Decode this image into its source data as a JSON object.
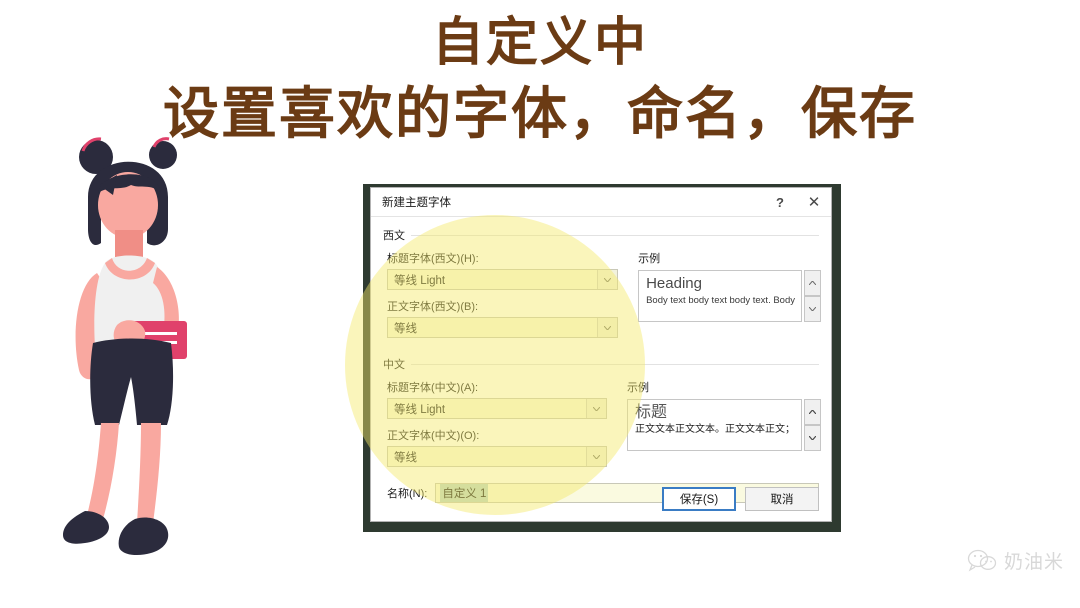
{
  "headline": {
    "line1": "自定义中",
    "line2": "设置喜欢的字体，命名，保存",
    "color": "#6b3b14"
  },
  "dialog": {
    "title": "新建主题字体",
    "help_icon": "?",
    "close_icon": "✕",
    "latin": {
      "group_label": "西文",
      "heading_font_label": "标题字体(西文)(H):",
      "heading_font_value": "等线 Light",
      "body_font_label": "正文字体(西文)(B):",
      "body_font_value": "等线",
      "sample_label": "示例",
      "sample_heading": "Heading",
      "sample_body": "Body text body text body text. Body"
    },
    "chinese": {
      "group_label": "中文",
      "heading_font_label": "标题字体(中文)(A):",
      "heading_font_value": "等线 Light",
      "body_font_label": "正文字体(中文)(O):",
      "body_font_value": "等线",
      "sample_label": "示例",
      "sample_heading": "标题",
      "sample_body": "正文文本正文文本。正文文本正文；"
    },
    "name": {
      "label": "名称(N):",
      "value": "自定义 1"
    },
    "buttons": {
      "save": "保存(S)",
      "cancel": "取消"
    },
    "accent_color": "#3a7cc4",
    "field_highlight_color": "#fafae0",
    "selection_color": "#bcd6c8"
  },
  "watermark": {
    "text": "奶油米",
    "icon": "wechat-icon"
  },
  "illustration": {
    "name": "girl-with-card",
    "skin": "#f9a8a0",
    "hair": "#2b2b3d",
    "top": "#f0f0f0",
    "shorts": "#2b2b3d",
    "card": "#e0416b"
  },
  "spotlight": {
    "name": "yellow-highlight-circle",
    "color": "#f4e869"
  }
}
